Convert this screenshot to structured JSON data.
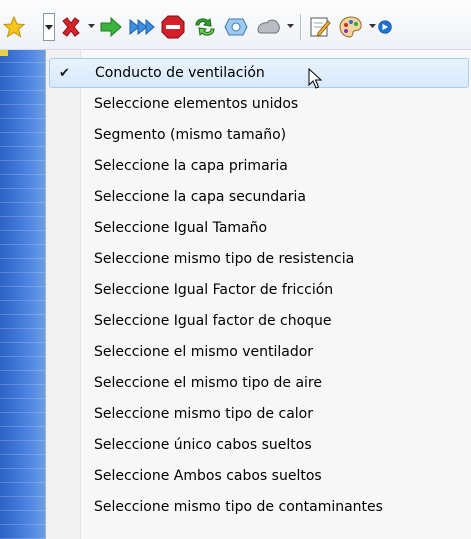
{
  "toolbar": {
    "icons": [
      "star-icon",
      "dropdown-arrow-icon",
      "red-x-icon",
      "dropdown-arrow-icon",
      "green-arrow-right-icon",
      "blue-double-arrow-icon",
      "stop-sign-icon",
      "green-cycle-arrows-icon",
      "blue-gear-icon",
      "gray-gear-icon",
      "dropdown-arrow-icon",
      "notepad-pencil-icon",
      "paint-palette-icon",
      "dropdown-arrow-icon",
      "blue-circle-icon"
    ]
  },
  "menu": {
    "items": [
      {
        "label": "Conducto de ventilación",
        "checked": true,
        "selected": true
      },
      {
        "label": "Seleccione elementos unidos",
        "checked": false,
        "selected": false
      },
      {
        "label": "Segmento (mismo tamaño)",
        "checked": false,
        "selected": false
      },
      {
        "label": "Seleccione la capa primaria",
        "checked": false,
        "selected": false
      },
      {
        "label": "Seleccione la capa secundaria",
        "checked": false,
        "selected": false
      },
      {
        "label": "Seleccione Igual Tamaño",
        "checked": false,
        "selected": false
      },
      {
        "label": "Seleccione mismo tipo de resistencia",
        "checked": false,
        "selected": false
      },
      {
        "label": "Seleccione Igual Factor de fricción",
        "checked": false,
        "selected": false
      },
      {
        "label": "Seleccione Igual factor de choque",
        "checked": false,
        "selected": false
      },
      {
        "label": "Seleccione el mismo ventilador",
        "checked": false,
        "selected": false
      },
      {
        "label": "Seleccione el mismo tipo de aire",
        "checked": false,
        "selected": false
      },
      {
        "label": "Seleccione mismo tipo de calor",
        "checked": false,
        "selected": false
      },
      {
        "label": "Seleccione único cabos sueltos",
        "checked": false,
        "selected": false
      },
      {
        "label": "Seleccione Ambos cabos sueltos",
        "checked": false,
        "selected": false
      },
      {
        "label": "Seleccione mismo tipo de contaminantes",
        "checked": false,
        "selected": false
      }
    ],
    "check_glyph": "✔"
  },
  "colors": {
    "selection_fill": "#d6e9fb",
    "selection_border": "#a8cdf2",
    "background_blue": "#3a6fd0"
  }
}
